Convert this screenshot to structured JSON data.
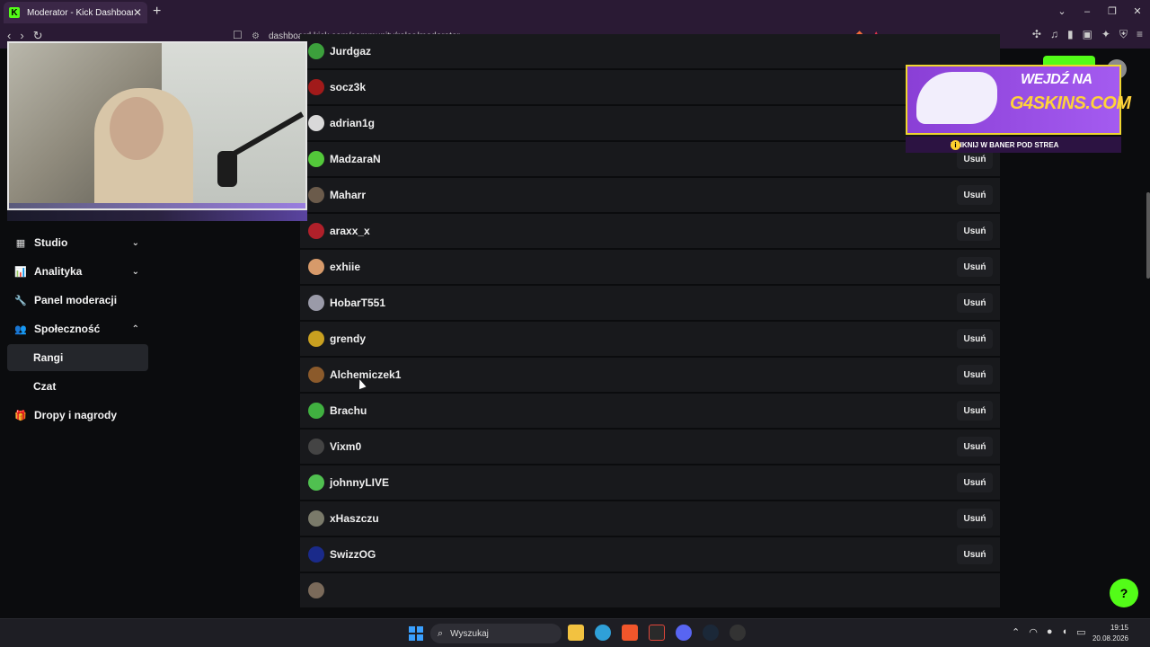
{
  "browser": {
    "tab_title": "Moderator - Kick Dashboard",
    "tab_favicon": "K",
    "new_tab": "+",
    "url": "dashboard.kick.com/community/roles/moderator",
    "nav": {
      "back": "‹",
      "forward": "›",
      "reload": "↻"
    },
    "window": {
      "chevron": "⌄",
      "minimize": "–",
      "maximize": "❐",
      "close": "✕"
    }
  },
  "sidebar": {
    "items": [
      {
        "label": "Studio",
        "icon": "studio-icon",
        "chevron": "⌄"
      },
      {
        "label": "Analityka",
        "icon": "chart-icon",
        "chevron": "⌄"
      },
      {
        "label": "Panel moderacji",
        "icon": "wrench-icon"
      },
      {
        "label": "Społeczność",
        "icon": "users-icon",
        "chevron": "⌃"
      },
      {
        "label": "Rangi"
      },
      {
        "label": "Czat"
      },
      {
        "label": "Dropy i nagrody",
        "icon": "gift-icon"
      }
    ]
  },
  "ad": {
    "headline": "WEJDŹ NA",
    "brand": "G4SKINS.COM",
    "subline": "KLIKNIJ W BANER POD STREA",
    "info_glyph": "i"
  },
  "moderators": {
    "remove_label": "Usuń",
    "rows": [
      {
        "name": "Jurdgaz",
        "avatar_color": "#3ca03c"
      },
      {
        "name": "socz3k",
        "avatar_color": "#a11a1a"
      },
      {
        "name": "adrian1g",
        "avatar_color": "#d9d9d9"
      },
      {
        "name": "MadzaraN",
        "avatar_color": "#53c83a"
      },
      {
        "name": "Maharr",
        "avatar_color": "#6b5b4b"
      },
      {
        "name": "araxx_x",
        "avatar_color": "#b0202a"
      },
      {
        "name": "exhiie",
        "avatar_color": "#d79a6a"
      },
      {
        "name": "HobarT551",
        "avatar_color": "#9a9aa8"
      },
      {
        "name": "grendy",
        "avatar_color": "#c9a020"
      },
      {
        "name": "Alchemiczek1",
        "avatar_color": "#8b5a2b"
      },
      {
        "name": "Brachu",
        "avatar_color": "#40b040"
      },
      {
        "name": "Vixm0",
        "avatar_color": "#444444"
      },
      {
        "name": "johnnyLIVE",
        "avatar_color": "#50c050"
      },
      {
        "name": "xHaszczu",
        "avatar_color": "#7a7a6a"
      },
      {
        "name": "SwizzOG",
        "avatar_color": "#1a2a8a"
      },
      {
        "name": "",
        "avatar_color": "#7a6a5a"
      }
    ]
  },
  "help_glyph": "?",
  "taskbar": {
    "search_placeholder": "Wyszukaj",
    "time": "19:15",
    "date": "20.08.2026",
    "tray": {
      "chevron": "⌃",
      "wifi": "◠",
      "mic": "●",
      "volume": "◖",
      "battery": "▭"
    }
  }
}
